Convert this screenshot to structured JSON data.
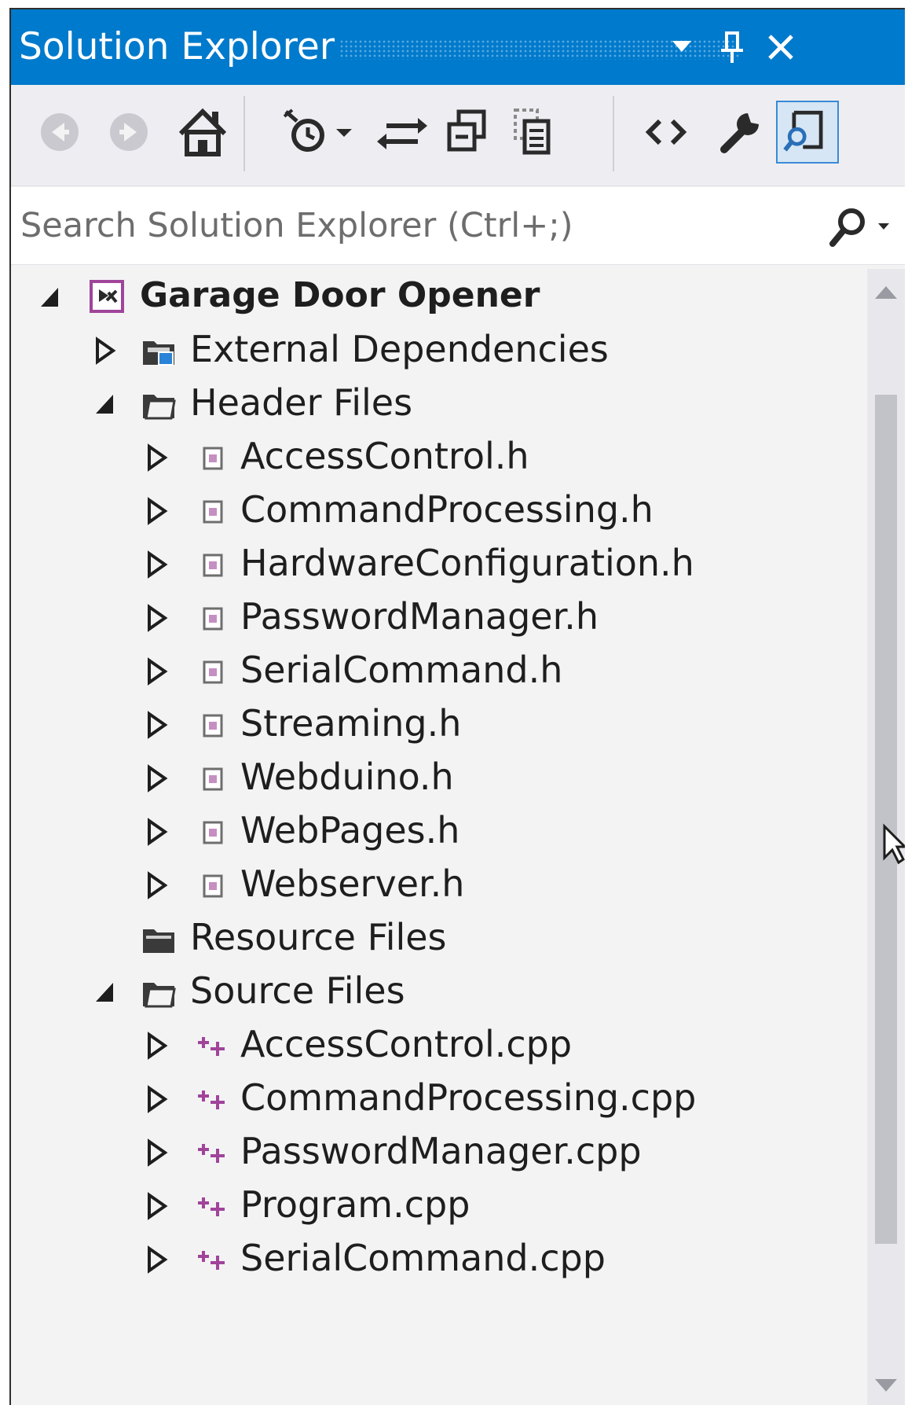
{
  "window": {
    "title": "Solution Explorer",
    "dropdown_icon": "chevron-down-icon",
    "pin_icon": "pin-icon",
    "close_icon": "close-icon"
  },
  "toolbar": {
    "items": [
      "back-icon",
      "forward-icon",
      "home-icon",
      "pending-changes-icon",
      "sync-icon",
      "collapse-all-icon",
      "show-all-files-icon",
      "view-code-icon",
      "properties-icon",
      "preview-selected-items-icon"
    ],
    "active_item": "preview-selected-items-icon"
  },
  "search": {
    "placeholder": "Search Solution Explorer (Ctrl+;)",
    "value": "",
    "icon": "search-icon"
  },
  "tree": {
    "root": {
      "label": "Garage Door Opener",
      "expanded": true
    },
    "external_dependencies": {
      "label": "External Dependencies",
      "expanded": false
    },
    "header_files": {
      "label": "Header Files",
      "expanded": true,
      "items": [
        "AccessControl.h",
        "CommandProcessing.h",
        "HardwareConfiguration.h",
        "PasswordManager.h",
        "SerialCommand.h",
        "Streaming.h",
        "Webduino.h",
        "WebPages.h",
        "Webserver.h"
      ]
    },
    "resource_files": {
      "label": "Resource Files"
    },
    "source_files": {
      "label": "Source Files",
      "expanded": true,
      "items": [
        "AccessControl.cpp",
        "CommandProcessing.cpp",
        "PasswordManager.cpp",
        "Program.cpp",
        "SerialCommand.cpp"
      ]
    }
  },
  "colors": {
    "titlebar": "#007acc",
    "panel_background": "#f3f3f4",
    "cpp_icon": "#a0449a",
    "toolbar_active": "#3a8ad6"
  }
}
